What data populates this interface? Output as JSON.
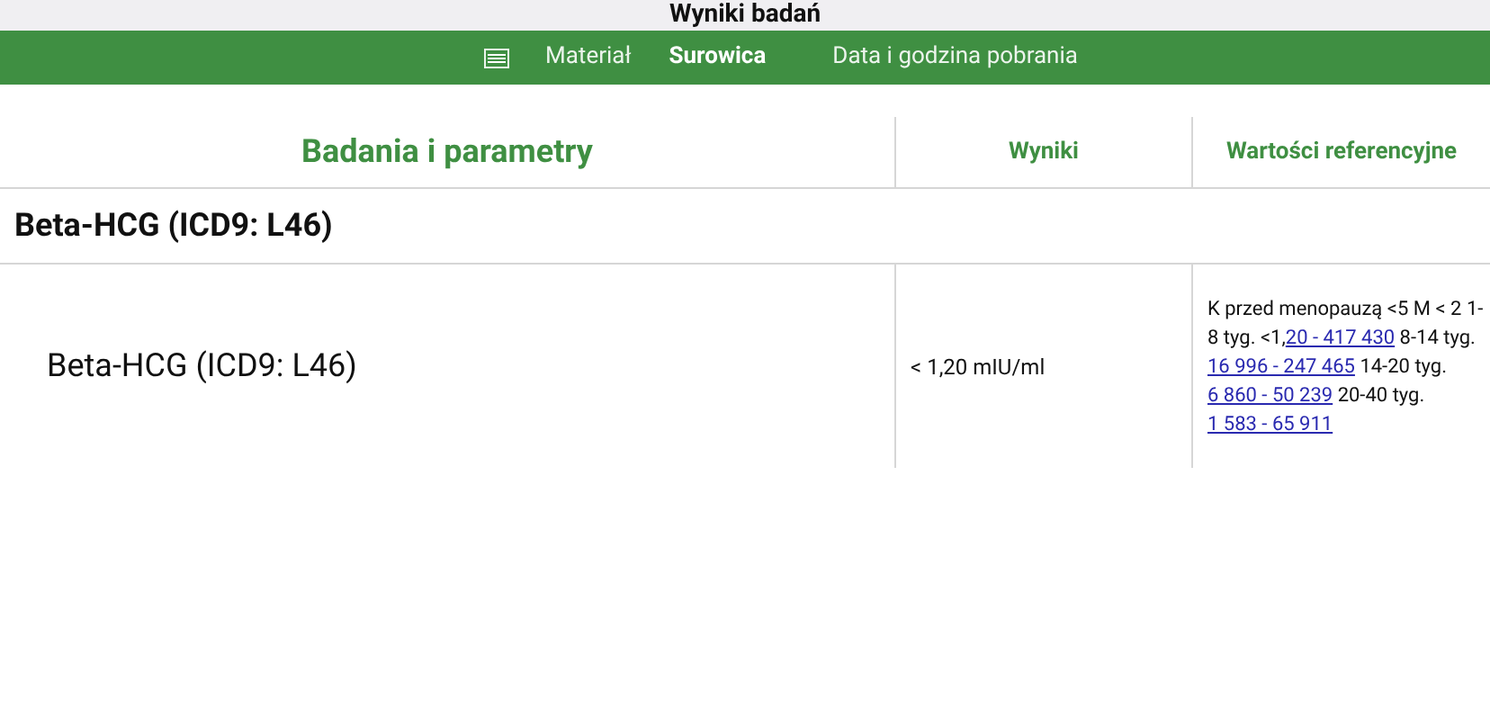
{
  "title": "Wyniki badań",
  "info_bar": {
    "material_label": "Materiał",
    "material_value": "Surowica",
    "date_label": "Data i godzina pobrania"
  },
  "table": {
    "columns": [
      "Badania i parametry",
      "Wyniki",
      "Wartości referencyjne"
    ],
    "sections": [
      {
        "title": "Beta-HCG (ICD9: L46)",
        "rows": [
          {
            "name": "Beta-HCG (ICD9: L46)",
            "result": "< 1,20 mIU/ml",
            "reference": [
              {
                "text": "K przed menopauzą <5 M < 2 1-8 tyg. <1,",
                "link": false
              },
              {
                "text": "20 - 417 430",
                "link": true
              },
              {
                "text": " 8-14 tyg. ",
                "link": false
              },
              {
                "text": "16 996 - 247 465",
                "link": true
              },
              {
                "text": " 14-20 tyg. ",
                "link": false
              },
              {
                "text": "6 860 - 50 239",
                "link": true
              },
              {
                "text": " 20-40 tyg. ",
                "link": false
              },
              {
                "text": "1 583 - 65 911",
                "link": true
              }
            ]
          }
        ]
      }
    ]
  }
}
